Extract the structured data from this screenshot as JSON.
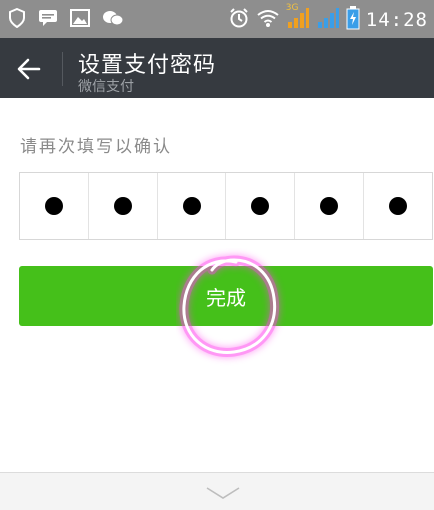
{
  "status_bar": {
    "time": "14:28",
    "network_label": "3G",
    "icons": [
      "shield-icon",
      "chat-icon",
      "image-icon",
      "wechat-icon",
      "alarm-icon",
      "wifi-icon",
      "signal-icon",
      "signal-icon",
      "battery-icon"
    ]
  },
  "header": {
    "title": "设置支付密码",
    "subtitle": "微信支付",
    "back_icon": "arrow-left-icon"
  },
  "form": {
    "hint": "请再次填写以确认",
    "pin_digits": [
      "●",
      "●",
      "●",
      "●",
      "●",
      "●"
    ],
    "done_label": "完成"
  },
  "colors": {
    "status_bar": "#8e8e8e",
    "header": "#363a40",
    "primary_button": "#45c01a",
    "annotation": "#ff44ee"
  },
  "keyboard": {
    "collapse_icon": "chevron-down-icon"
  }
}
